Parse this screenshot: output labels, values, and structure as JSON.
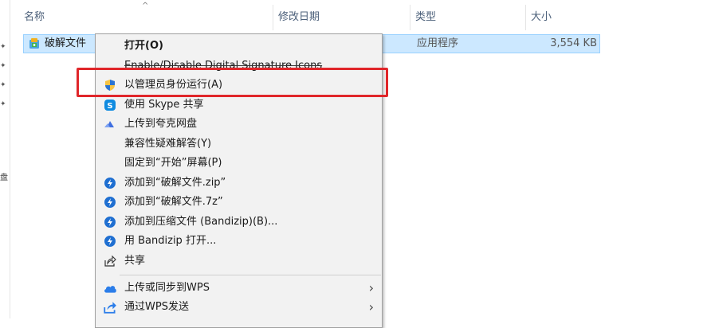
{
  "columns": {
    "name": "名称",
    "date_modified": "修改日期",
    "type": "类型",
    "size": "大小"
  },
  "file": {
    "name": "破解文件",
    "type": "应用程序",
    "size": "3,554 KB",
    "icon": "app-installer-icon"
  },
  "nav": {
    "glyph": "盘"
  },
  "context_menu": {
    "items": [
      {
        "label": "打开(O)",
        "icon": ""
      },
      {
        "label": "Enable/Disable Digital Signature Icons",
        "icon": ""
      },
      {
        "label": "以管理员身份运行(A)",
        "icon": "uac-shield-icon"
      },
      {
        "label": "使用 Skype 共享",
        "icon": "skype-icon"
      },
      {
        "label": "上传到夸克网盘",
        "icon": "quark-cloud-icon"
      },
      {
        "label": "兼容性疑难解答(Y)",
        "icon": ""
      },
      {
        "label": "固定到“开始”屏幕(P)",
        "icon": ""
      },
      {
        "label": "添加到“破解文件.zip”",
        "icon": "bandizip-icon"
      },
      {
        "label": "添加到“破解文件.7z”",
        "icon": "bandizip-icon"
      },
      {
        "label": "添加到压缩文件 (Bandizip)(B)...",
        "icon": "bandizip-icon"
      },
      {
        "label": "用 Bandizip 打开...",
        "icon": "bandizip-icon"
      },
      {
        "label": "共享",
        "icon": "share-icon"
      },
      {
        "label": "上传或同步到WPS",
        "icon": "wps-cloud-icon"
      },
      {
        "label": "通过WPS发送",
        "icon": "wps-send-icon"
      }
    ]
  },
  "colors": {
    "selection": "#cce8ff",
    "highlight": "#e0262a",
    "bandizip": "#1f6fd1"
  }
}
